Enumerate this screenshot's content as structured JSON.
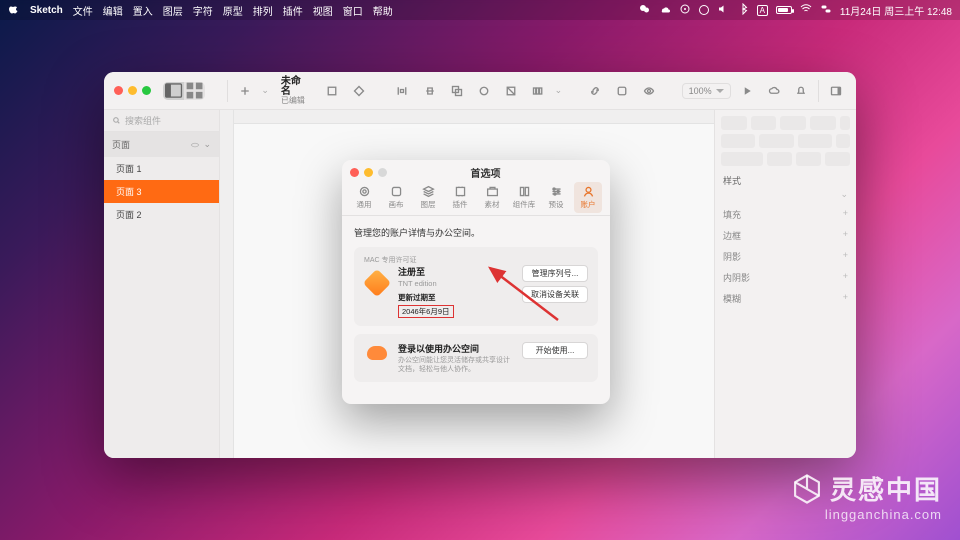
{
  "menubar": {
    "app": "Sketch",
    "items": [
      "文件",
      "编辑",
      "置入",
      "图层",
      "字符",
      "原型",
      "排列",
      "插件",
      "视图",
      "窗口",
      "帮助"
    ],
    "clock": "11月24日 周三上午 12:48"
  },
  "toolbar": {
    "title": "未命名",
    "subtitle": "已编辑",
    "zoom": "100%"
  },
  "sidebar": {
    "search_placeholder": "搜索组件",
    "group": "页面",
    "pages": [
      "页面 1",
      "页面 3",
      "页面 2"
    ],
    "active_index": 1
  },
  "inspector": {
    "style_head": "样式",
    "sections": [
      "填充",
      "边框",
      "阴影",
      "内阴影",
      "模糊"
    ]
  },
  "prefs": {
    "title": "首选项",
    "tabs": [
      "通用",
      "画布",
      "图层",
      "插件",
      "素材",
      "组件库",
      "预设",
      "账户"
    ],
    "active_tab": 7,
    "heading": "管理您的账户详情与办公空间。",
    "license": {
      "badge": "MAC 专用许可证",
      "reg_to": "注册至",
      "edition": "TNT edition",
      "renew_label": "更新过期至",
      "renew_date": "2046年6月9日",
      "btn_serial": "管理序列号...",
      "btn_unlink": "取消设备关联"
    },
    "workspace": {
      "title": "登录以使用办公空间",
      "desc": "办公空间能让您灵活储存或共享设计文档，轻松与他人协作。",
      "btn": "开始使用..."
    }
  },
  "watermark": {
    "big": "灵感中国",
    "small": "lingganchina.com"
  }
}
